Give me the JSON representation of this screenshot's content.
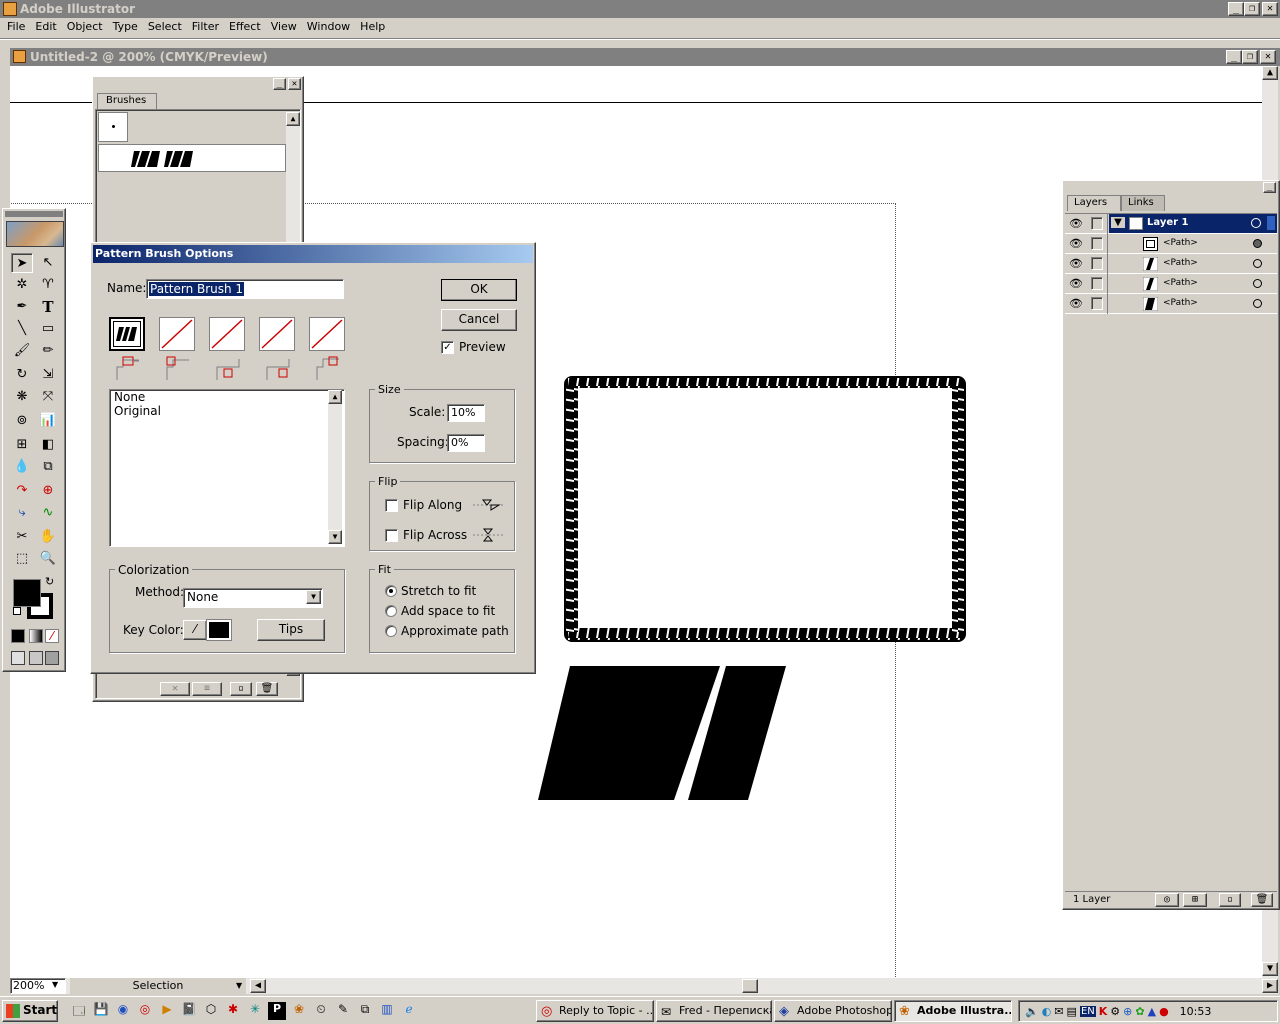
{
  "app": {
    "title": "Adobe Illustrator"
  },
  "menu": [
    "File",
    "Edit",
    "Object",
    "Type",
    "Select",
    "Filter",
    "Effect",
    "View",
    "Window",
    "Help"
  ],
  "document": {
    "title": "Untitled-2 @ 200% (CMYK/Preview)"
  },
  "brushes_panel": {
    "tab": "Brushes"
  },
  "dialog": {
    "title": "Pattern Brush Options",
    "name_label": "Name:",
    "name_value": "Pattern Brush 1",
    "ok": "OK",
    "cancel": "Cancel",
    "preview_label": "Preview",
    "preview_checked": true,
    "tile_list": [
      "None",
      "Original"
    ],
    "size": {
      "legend": "Size",
      "scale_label": "Scale:",
      "scale_value": "10%",
      "spacing_label": "Spacing:",
      "spacing_value": "0%"
    },
    "flip": {
      "legend": "Flip",
      "along_label": "Flip Along",
      "across_label": "Flip Across"
    },
    "fit": {
      "legend": "Fit",
      "options": [
        "Stretch to fit",
        "Add space to fit",
        "Approximate path"
      ],
      "selected": "Stretch to fit"
    },
    "colorization": {
      "legend": "Colorization",
      "method_label": "Method:",
      "method_value": "None",
      "key_color_label": "Key Color:",
      "tips": "Tips"
    }
  },
  "layers_panel": {
    "tabs": [
      "Layers",
      "Links"
    ],
    "layer_name": "Layer 1",
    "paths": [
      "<Path>",
      "<Path>",
      "<Path>",
      "<Path>"
    ],
    "footer": "1 Layer"
  },
  "status": {
    "zoom": "200%",
    "tool": "Selection"
  },
  "taskbar": {
    "start": "Start",
    "tasks": [
      "Reply to Topic - ...",
      "Fred - Переписка",
      "Adobe Photoshop",
      "Adobe Illustra..."
    ],
    "active_task": "Adobe Illustra...",
    "lang": "EN",
    "clock": "10:53"
  },
  "colors": {
    "titlebar_active": "#0a246a",
    "titlebar_inactive": "#808080",
    "face": "#d4d0c8",
    "accent_red": "#cc0000"
  }
}
